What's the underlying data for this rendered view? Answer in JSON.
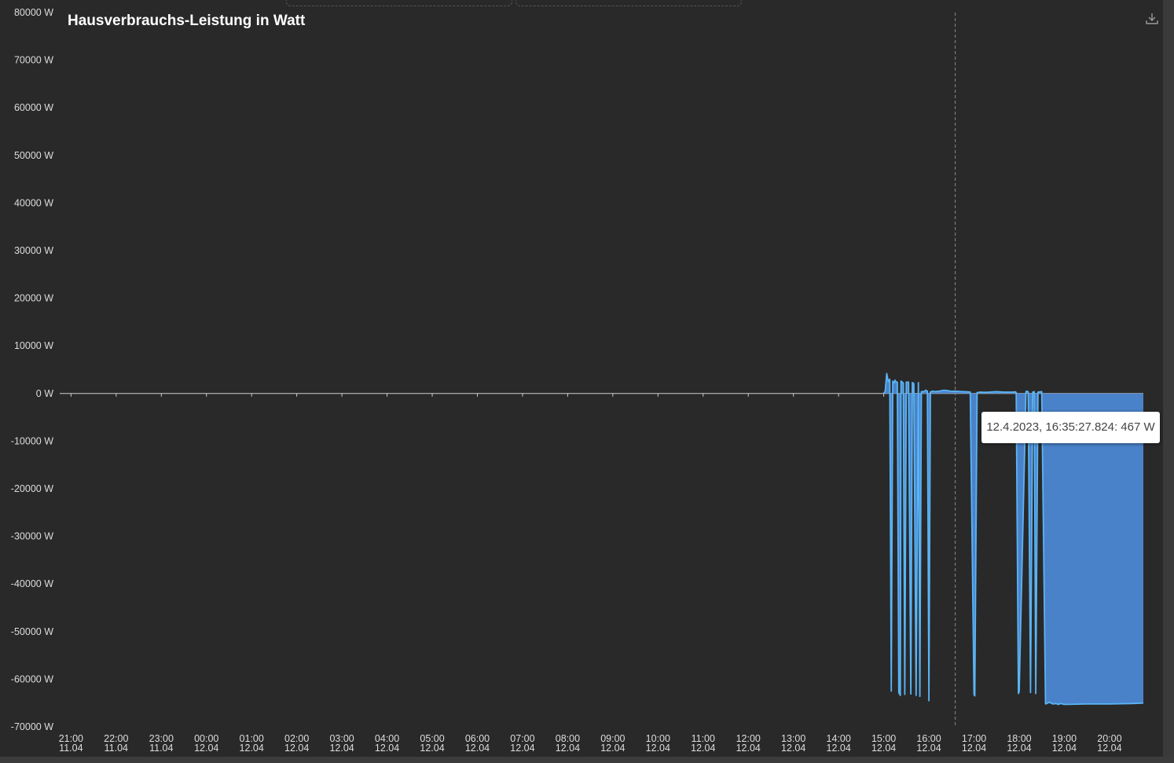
{
  "icons": {
    "download": "download-icon"
  },
  "colors": {
    "background": "#292929",
    "series_line": "#5ab4f5",
    "series_fill": "#4a82c9",
    "axis_text": "#dddddd",
    "tooltip_bg": "#ffffff"
  },
  "tooltip": {
    "text": "12.4.2023, 16:35:27.824: 467 W"
  },
  "crosshair": {
    "time": "16:35"
  },
  "chart_data": {
    "type": "area",
    "title": "Hausverbrauchs-Leistung in Watt",
    "xlabel": "",
    "ylabel": "",
    "ylim": [
      -70000,
      80000
    ],
    "xlim": [
      "11.04 20:45",
      "12.04 20:45"
    ],
    "grid": false,
    "y_ticks": [
      "80000 W",
      "70000 W",
      "60000 W",
      "50000 W",
      "40000 W",
      "30000 W",
      "20000 W",
      "10000 W",
      "0 W",
      "-10000 W",
      "-20000 W",
      "-30000 W",
      "-40000 W",
      "-50000 W",
      "-60000 W",
      "-70000 W"
    ],
    "x_ticks": [
      {
        "time": "21:00",
        "date": "11.04"
      },
      {
        "time": "22:00",
        "date": "11.04"
      },
      {
        "time": "23:00",
        "date": "11.04"
      },
      {
        "time": "00:00",
        "date": "12.04"
      },
      {
        "time": "01:00",
        "date": "12.04"
      },
      {
        "time": "02:00",
        "date": "12.04"
      },
      {
        "time": "03:00",
        "date": "12.04"
      },
      {
        "time": "04:00",
        "date": "12.04"
      },
      {
        "time": "05:00",
        "date": "12.04"
      },
      {
        "time": "06:00",
        "date": "12.04"
      },
      {
        "time": "07:00",
        "date": "12.04"
      },
      {
        "time": "08:00",
        "date": "12.04"
      },
      {
        "time": "09:00",
        "date": "12.04"
      },
      {
        "time": "10:00",
        "date": "12.04"
      },
      {
        "time": "11:00",
        "date": "12.04"
      },
      {
        "time": "12:00",
        "date": "12.04"
      },
      {
        "time": "13:00",
        "date": "12.04"
      },
      {
        "time": "14:00",
        "date": "12.04"
      },
      {
        "time": "15:00",
        "date": "12.04"
      },
      {
        "time": "16:00",
        "date": "12.04"
      },
      {
        "time": "17:00",
        "date": "12.04"
      },
      {
        "time": "18:00",
        "date": "12.04"
      },
      {
        "time": "19:00",
        "date": "12.04"
      },
      {
        "time": "20:00",
        "date": "12.04"
      }
    ],
    "series": [
      {
        "x": [
          "15:00",
          "15:02",
          "15:04",
          "15:06",
          "15:08",
          "15:10",
          "15:12",
          "15:14",
          "15:15",
          "15:16",
          "15:18",
          "15:20",
          "15:21",
          "15:22",
          "15:23",
          "15:24",
          "15:26",
          "15:28",
          "15:30",
          "15:33",
          "15:36",
          "15:38",
          "15:40",
          "15:43",
          "15:46",
          "15:48",
          "15:50",
          "15:53",
          "15:55",
          "15:56",
          "15:58",
          "16:00",
          "16:02",
          "16:03",
          "16:05",
          "16:08",
          "16:10",
          "16:14",
          "16:20",
          "16:25",
          "16:30",
          "16:35",
          "16:40",
          "16:45",
          "16:52",
          "16:55",
          "17:00",
          "17:01",
          "17:04",
          "17:08",
          "17:15",
          "17:20",
          "17:30",
          "17:40",
          "17:50",
          "17:55",
          "17:56",
          "17:59",
          "18:00",
          "18:09",
          "18:10",
          "18:12",
          "18:15",
          "18:18",
          "18:20",
          "18:22",
          "18:25",
          "18:30",
          "18:35",
          "18:38",
          "18:40",
          "18:42",
          "18:45",
          "18:49",
          "18:52",
          "18:55",
          "19:00",
          "19:30",
          "20:00",
          "20:30",
          "20:45"
        ],
        "values": [
          0,
          500,
          4200,
          2500,
          3000,
          -62500,
          2600,
          2200,
          2800,
          2500,
          2400,
          -62800,
          -63100,
          -63400,
          2600,
          2500,
          2200,
          -63200,
          2400,
          2400,
          -63100,
          2300,
          2100,
          -63400,
          2300,
          -63600,
          400,
          400,
          600,
          700,
          500,
          -64500,
          300,
          400,
          500,
          400,
          450,
          500,
          700,
          600,
          467,
          500,
          450,
          400,
          350,
          300,
          -63200,
          -63500,
          200,
          300,
          250,
          300,
          400,
          300,
          300,
          350,
          200,
          -63000,
          -62600,
          400,
          500,
          350,
          -62800,
          300,
          400,
          -63000,
          300,
          400,
          -65200,
          -65000,
          -64800,
          -65000,
          -65200,
          -65100,
          -65300,
          -65100,
          -65300,
          -65200,
          -65200,
          -65100,
          -65000
        ]
      }
    ]
  }
}
